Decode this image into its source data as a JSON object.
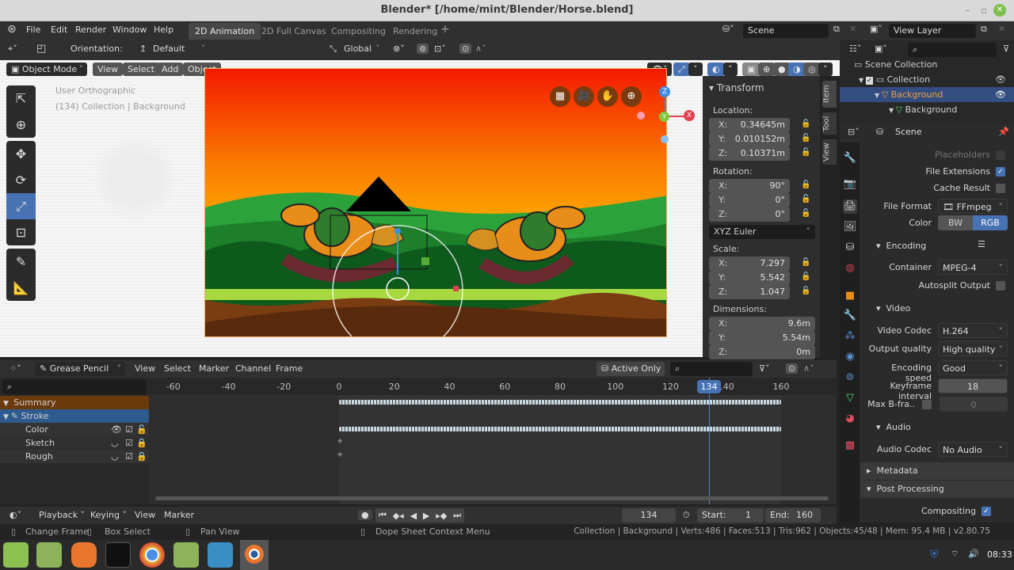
{
  "window": {
    "title": "Blender* [/home/mint/Blender/Horse.blend]"
  },
  "menu": {
    "items": [
      "File",
      "Edit",
      "Render",
      "Window",
      "Help"
    ]
  },
  "workspaces": [
    {
      "label": "2D Animation",
      "active": true
    },
    {
      "label": "2D Full Canvas",
      "active": false
    },
    {
      "label": "Compositing",
      "active": false
    },
    {
      "label": "Rendering",
      "active": false
    }
  ],
  "scene_selector": {
    "value": "Scene"
  },
  "view_layer_selector": {
    "value": "View Layer"
  },
  "tool_header": {
    "orientation_label": "Orientation:",
    "orientation_value": "Default",
    "transform_orientation": "Global"
  },
  "viewport_header": {
    "mode": "Object Mode",
    "menus": [
      "View",
      "Select",
      "Add",
      "Object"
    ]
  },
  "viewport_overlay": {
    "view_name": "User Orthographic",
    "context": "(134) Collection | Background"
  },
  "gizmo_axes": {
    "z": "Z",
    "y": "Y",
    "x": "X"
  },
  "npanel": {
    "section": "Transform",
    "location_label": "Location:",
    "location": {
      "x": "0.34645m",
      "y": "0.010152m",
      "z": "0.10371m"
    },
    "rotation_label": "Rotation:",
    "rotation": {
      "x": "90°",
      "y": "0°",
      "z": "0°"
    },
    "rotation_mode": "XYZ Euler",
    "scale_label": "Scale:",
    "scale": {
      "x": "7.297",
      "y": "5.542",
      "z": "1.047"
    },
    "dimensions_label": "Dimensions:",
    "dimensions": {
      "x": "9.6m",
      "y": "5.54m",
      "z": "0m"
    },
    "tabs": [
      "Item",
      "Tool",
      "View"
    ]
  },
  "outliner": {
    "rows": [
      {
        "label": "Scene Collection"
      },
      {
        "label": "Collection"
      },
      {
        "label": "Background",
        "selected": true
      },
      {
        "label": "Background"
      }
    ]
  },
  "properties": {
    "context": "Scene",
    "placeholders_label": "Placeholders",
    "file_extensions_label": "File Extensions",
    "file_extensions": true,
    "cache_result_label": "Cache Result",
    "cache_result": false,
    "file_format_label": "File Format",
    "file_format": "FFmpeg vi...",
    "color_label": "Color",
    "color_options": [
      "BW",
      "RGB"
    ],
    "color_selected": "RGB",
    "encoding_label": "Encoding",
    "container_label": "Container",
    "container": "MPEG-4",
    "autosplit_label": "Autosplit Output",
    "video_label": "Video",
    "video_codec_label": "Video Codec",
    "video_codec": "H.264",
    "output_quality_label": "Output quality",
    "output_quality": "High quality",
    "encoding_speed_label": "Encoding speed",
    "encoding_speed": "Good",
    "keyframe_interval_label": "Keyframe interval",
    "keyframe_interval": "18",
    "max_bframes_label": "Max B-fra..",
    "max_bframes": "0",
    "audio_label": "Audio",
    "audio_codec_label": "Audio Codec",
    "audio_codec": "No Audio",
    "metadata_label": "Metadata",
    "post_processing_label": "Post Processing",
    "compositing_label": "Compositing",
    "compositing": true
  },
  "dopesheet": {
    "mode": "Grease Pencil",
    "menus": [
      "View",
      "Select",
      "Marker",
      "Channel",
      "Frame"
    ],
    "active_only": "Active Only",
    "ticks": [
      "-60",
      "-40",
      "-20",
      "0",
      "20",
      "40",
      "60",
      "80",
      "100",
      "120",
      "140",
      "160"
    ],
    "current_frame": "134",
    "channels": [
      {
        "label": "Summary",
        "type": "summary"
      },
      {
        "label": "Stroke",
        "type": "object"
      },
      {
        "label": "Color",
        "type": "layer"
      },
      {
        "label": "Sketch",
        "type": "layer"
      },
      {
        "label": "Rough",
        "type": "layer"
      }
    ]
  },
  "timeline": {
    "menus": [
      "Playback",
      "Keying",
      "View",
      "Marker"
    ],
    "current_frame": "134",
    "start_label": "Start:",
    "start": "1",
    "end_label": "End:",
    "end": "160"
  },
  "statusbar": {
    "hints": [
      "Change Frame",
      "Box Select",
      "Pan View",
      "Dope Sheet Context Menu"
    ],
    "stats": "Collection | Background | Verts:486 | Faces:513 | Tris:962 | Objects:45/48 | Mem: 95.4 MB | v2.80.75"
  },
  "taskbar": {
    "clock": "08:33"
  }
}
